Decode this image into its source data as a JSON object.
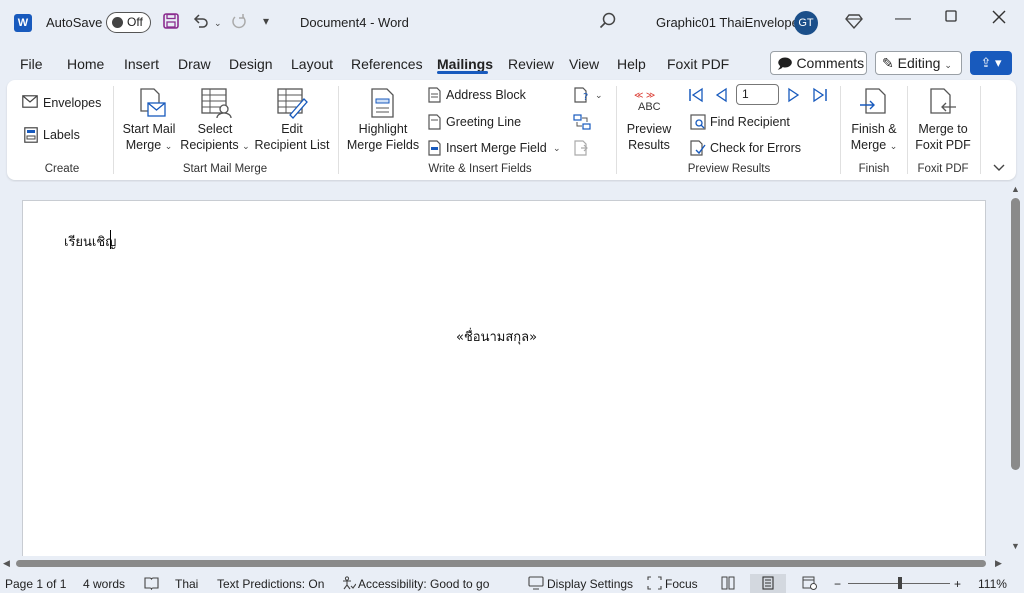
{
  "titlebar": {
    "app_icon": "W",
    "autosave_label": "AutoSave",
    "autosave_state": "Off",
    "document_title": "Document4  -  Word",
    "profile_name": "Graphic01 ThaiEnvelope",
    "avatar_initials": "GT",
    "icons": [
      "save-icon",
      "undo-icon",
      "redo-icon",
      "customize-icon",
      "search-icon",
      "diamond-icon",
      "minimize-icon",
      "maximize-icon",
      "close-icon"
    ]
  },
  "tabs": [
    "File",
    "Home",
    "Insert",
    "Draw",
    "Design",
    "Layout",
    "References",
    "Mailings",
    "Review",
    "View",
    "Help",
    "Foxit PDF"
  ],
  "active_tab": "Mailings",
  "header_buttons": {
    "comments": "Comments",
    "editing": "Editing",
    "editing_chevron": "⌄"
  },
  "ribbon": {
    "create": {
      "label": "Create",
      "envelopes": "Envelopes",
      "labels": "Labels"
    },
    "start_mail_merge": {
      "label": "Start Mail Merge",
      "start_line1": "Start Mail",
      "start_line2": "Merge",
      "select_line1": "Select",
      "select_line2": "Recipients",
      "edit_line1": "Edit",
      "edit_line2": "Recipient List"
    },
    "write_insert": {
      "label": "Write & Insert Fields",
      "highlight_line1": "Highlight",
      "highlight_line2": "Merge Fields",
      "address_block": "Address Block",
      "greeting_line": "Greeting Line",
      "insert_merge_field": "Insert Merge Field"
    },
    "preview": {
      "label": "Preview Results",
      "abc": "ABC",
      "preview_line1": "Preview",
      "preview_line2": "Results",
      "record_number": "1",
      "find_recipient": "Find Recipient",
      "check_errors": "Check for Errors"
    },
    "finish": {
      "label": "Finish",
      "finish_line1": "Finish &",
      "finish_line2": "Merge"
    },
    "foxit": {
      "label": "Foxit PDF",
      "merge_line1": "Merge to",
      "merge_line2": "Foxit PDF"
    }
  },
  "document": {
    "line1": "เรียนเชิญ",
    "merge_field": "«ชื่อนามสกุล»"
  },
  "statusbar": {
    "page": "Page 1 of 1",
    "words": "4 words",
    "language": "Thai",
    "text_predictions": "Text Predictions: On",
    "accessibility": "Accessibility: Good to go",
    "display_settings": "Display Settings",
    "focus": "Focus",
    "zoom_minus": "−",
    "zoom_plus": "+",
    "zoom": "111%"
  },
  "colors": {
    "accent": "#185abd",
    "background": "#e9eef6",
    "ribbon": "#ffffff",
    "page": "#ffffff"
  }
}
